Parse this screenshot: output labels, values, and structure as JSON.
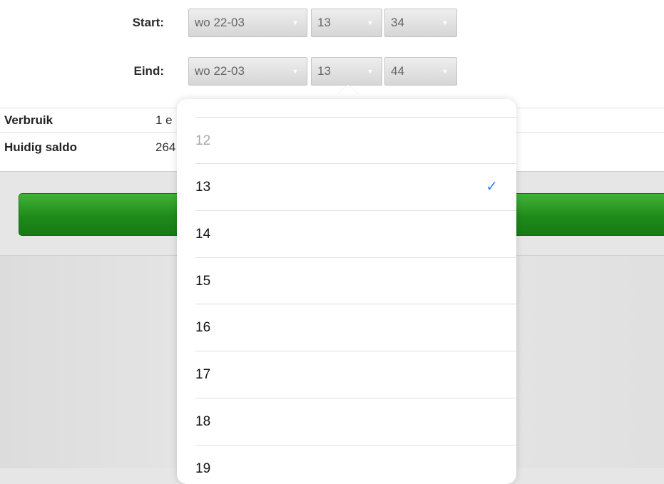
{
  "form": {
    "start": {
      "label": "Start:",
      "date": "wo 22-03",
      "hour": "13",
      "minute": "34"
    },
    "end": {
      "label": "Eind:",
      "date": "wo 22-03",
      "hour": "13",
      "minute": "44"
    }
  },
  "info": {
    "usage_label": "Verbruik",
    "usage_value": "1 e",
    "balance_label": "Huidig saldo",
    "balance_value": "264"
  },
  "hour_picker": {
    "options": [
      "12",
      "13",
      "14",
      "15",
      "16",
      "17",
      "18",
      "19"
    ],
    "selected": "13",
    "check_symbol": "✓"
  },
  "icons": {
    "dropdown_arrow": "▼"
  },
  "colors": {
    "primary_button": "#1f8a1a",
    "check_accent": "#2f7ff0"
  }
}
